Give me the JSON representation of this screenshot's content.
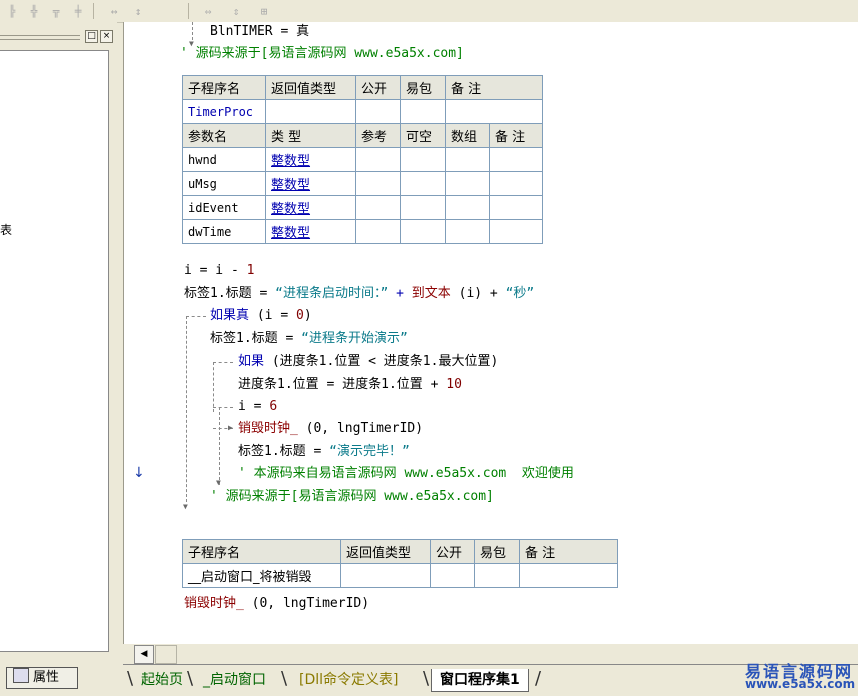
{
  "toolbar": {
    "icons": [
      "align-left-icon",
      "align-center-icon",
      "align-top-icon",
      "align-middle-icon",
      "space-horizontal-icon",
      "space-vertical-icon",
      "same-width-icon",
      "same-height-icon",
      "same-size-icon"
    ]
  },
  "left_panel": {
    "close_label": "×",
    "restore_label": "□",
    "partial_char": "表",
    "properties_tab": "属性"
  },
  "code": {
    "line_bln": "BlnTIMER = 真",
    "comment_top": "' 源码来源于[易语言源码网 www.e5a5x.com]",
    "table1": {
      "header": [
        "子程序名",
        "返回值类型",
        "公开",
        "易包",
        "备 注"
      ],
      "name": "TimerProc",
      "param_header": [
        "参数名",
        "类 型",
        "参考",
        "可空",
        "数组",
        "备 注"
      ],
      "params": [
        {
          "name": "hwnd",
          "type": "整数型"
        },
        {
          "name": "uMsg",
          "type": "整数型"
        },
        {
          "name": "idEvent",
          "type": "整数型"
        },
        {
          "name": "dwTime",
          "type": "整数型"
        }
      ]
    },
    "l_i": {
      "a": "i = i - ",
      "b": "1"
    },
    "l_label1": {
      "a": "标签1.标题 = ",
      "b": "“进程条启动时间：”",
      "c": " + ",
      "d": "到文本",
      "e": " (i) + ",
      "f": "“秒”"
    },
    "l_ifreal": {
      "a": "如果真",
      "b": " (i = ",
      "c": "0",
      "d": ")"
    },
    "l_label2": {
      "a": "标签1.标题 = ",
      "b": "“进程条开始演示”"
    },
    "l_if": {
      "a": "如果",
      "b": " (进度条1.位置 < 进度条1.最大位置)"
    },
    "l_pos": {
      "a": "进度条1.位置 = 进度条1.位置 + ",
      "b": "10"
    },
    "l_i6": {
      "a": "i = ",
      "b": "6"
    },
    "l_destroy": {
      "a": "销毁时钟_",
      "b": " (0, lngTimerID)"
    },
    "l_label3": {
      "a": "标签1.标题 = ",
      "b": "“演示完毕！”"
    },
    "l_comment_mid": "' 本源码来自易语言源码网 www.e5a5x.com  欢迎使用",
    "l_comment_bot": "' 源码来源于[易语言源码网 www.e5a5x.com]",
    "table2": {
      "header": [
        "子程序名",
        "返回值类型",
        "公开",
        "易包",
        "备 注"
      ],
      "name": "__启动窗口_将被销毁"
    },
    "l_destroy2": {
      "a": "销毁时钟_",
      "b": " (0, lngTimerID)"
    }
  },
  "scroll": {
    "left_arrow": "◀"
  },
  "tabs": [
    "起始页",
    "_启动窗口",
    "[Dll命令定义表]",
    "窗口程序集1"
  ],
  "watermark": {
    "line1": "易语言源码网",
    "line2": "www.e5a5x.com"
  },
  "colors": {
    "keyword": "#0000b0",
    "string": "#0b7a8a",
    "comment": "#008000",
    "number": "#800000",
    "accent": "#2a54b8"
  }
}
